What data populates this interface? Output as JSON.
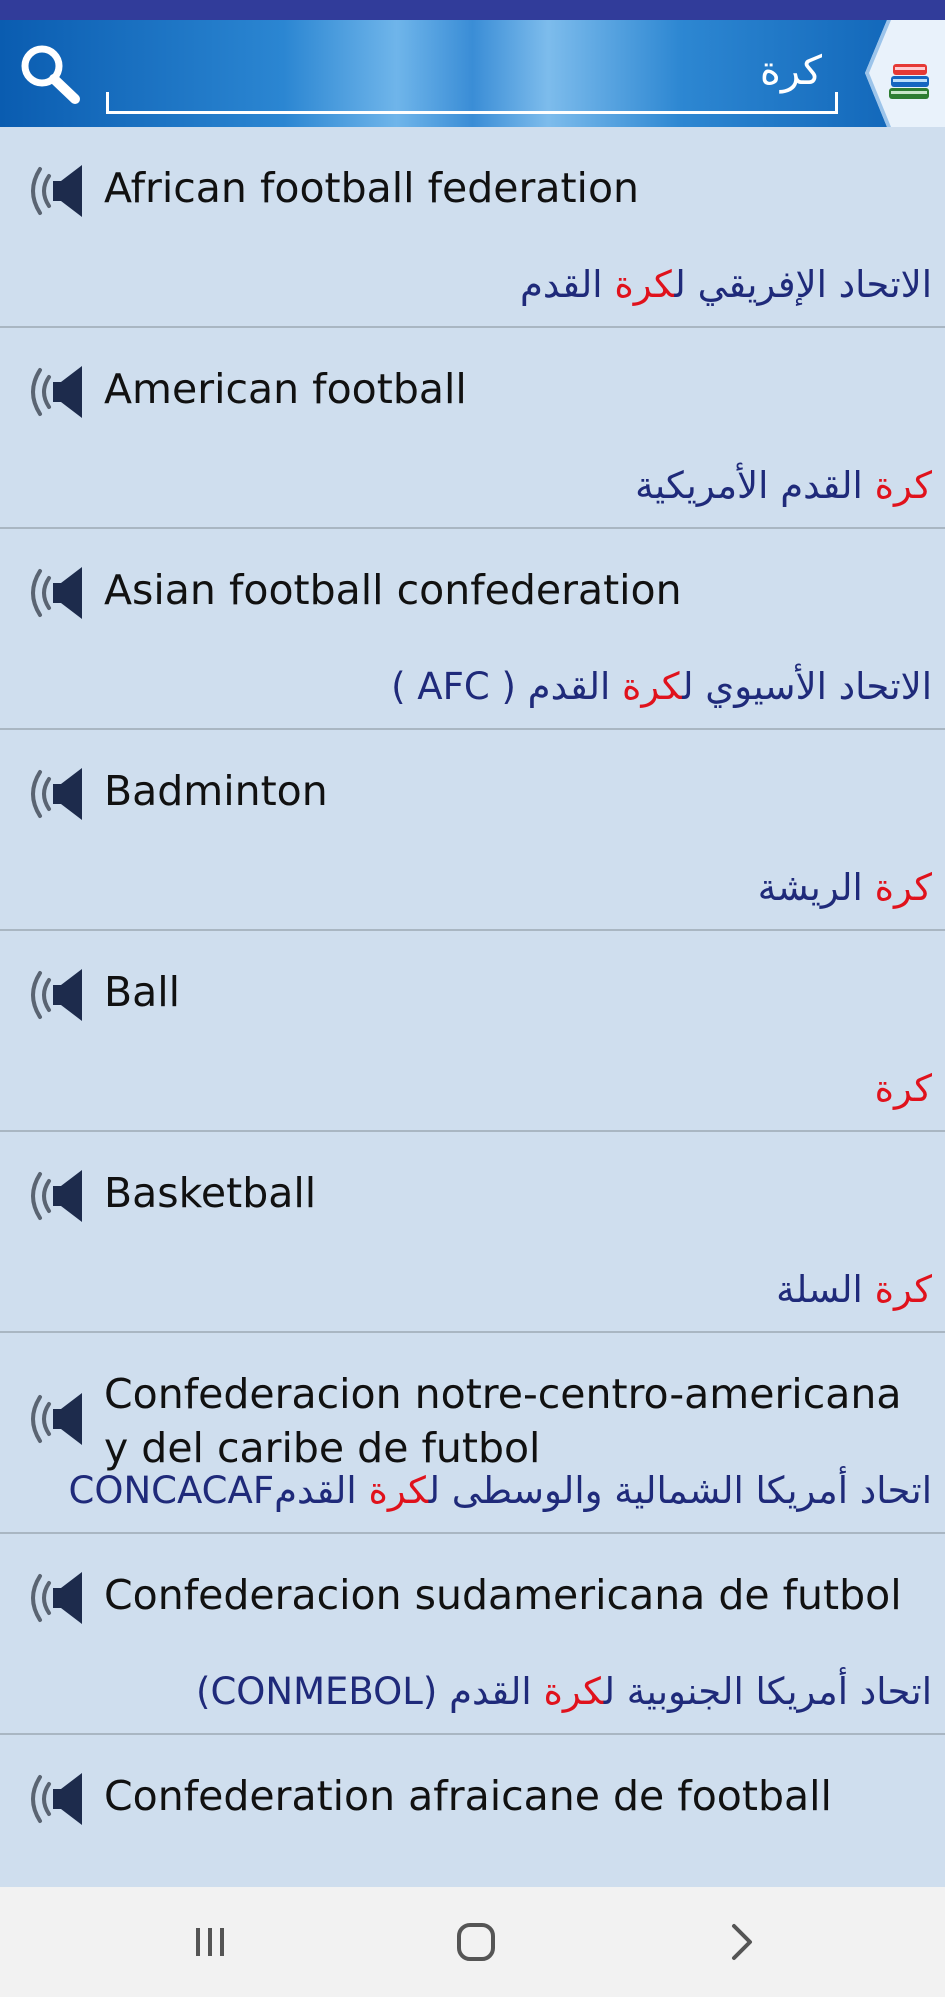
{
  "search": {
    "query": "كرة",
    "search_icon": "search-icon",
    "app_icon": "books-icon"
  },
  "colors": {
    "header_accent": "#1565c0",
    "highlight": "#e0121c",
    "arabic_text": "#1f2a7a",
    "list_bg": "#cfdeee"
  },
  "items": [
    {
      "en": "African football federation",
      "ar_before": "الاتحاد الإفريقي ل",
      "ar_hl": "كرة",
      "ar_after": " القدم"
    },
    {
      "en": "American football",
      "ar_before": "",
      "ar_hl": "كرة",
      "ar_after": " القدم الأمريكية"
    },
    {
      "en": "Asian football confederation",
      "ar_before": "الاتحاد الأسيوي ل",
      "ar_hl": "كرة",
      "ar_after": " القدم ( AFC )"
    },
    {
      "en": "Badminton",
      "ar_before": "",
      "ar_hl": "كرة",
      "ar_after": " الريشة"
    },
    {
      "en": "Ball",
      "ar_before": "",
      "ar_hl": "كرة",
      "ar_after": ""
    },
    {
      "en": "Basketball",
      "ar_before": "",
      "ar_hl": "كرة",
      "ar_after": " السلة"
    },
    {
      "en": "Confederacion notre-centro-americana y del caribe de futbol",
      "ar_before": "اتحاد أمريكا الشمالية والوسطى ل",
      "ar_hl": "كرة",
      "ar_after": " القدمCONCACAF"
    },
    {
      "en": "Confederacion sudamericana de futbol",
      "ar_before": "اتحاد أمريكا الجنوبية ل",
      "ar_hl": "كرة",
      "ar_after": " القدم (CONMEBOL)"
    },
    {
      "en": "Confederation afraicane de football",
      "ar_before": "",
      "ar_hl": "",
      "ar_after": ""
    }
  ],
  "nav": {
    "recents": "recents-icon",
    "home": "home-icon",
    "back": "back-icon"
  }
}
